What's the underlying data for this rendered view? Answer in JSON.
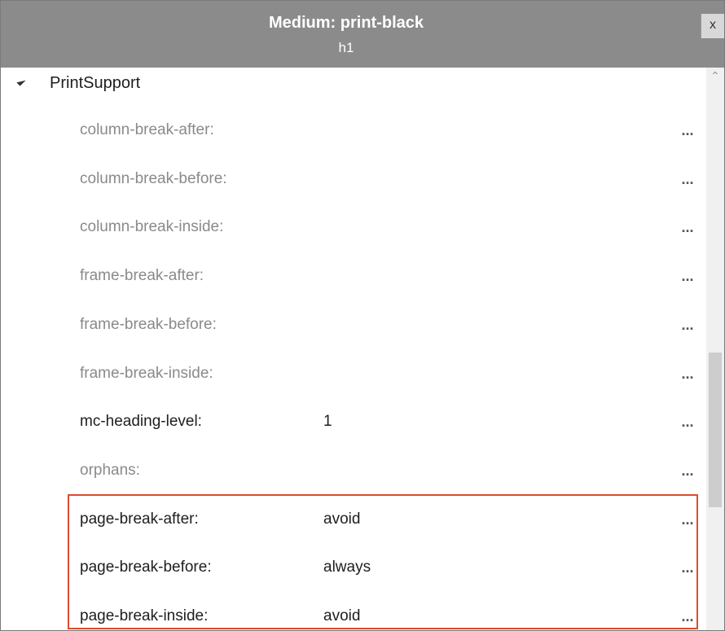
{
  "window": {
    "title": "Medium: print-black",
    "subtitle": "h1",
    "close_label": "x"
  },
  "group": {
    "label": "PrintSupport",
    "expanded": true
  },
  "ellipsis_label": "...",
  "properties": [
    {
      "name": "column-break-after:",
      "value": ""
    },
    {
      "name": "column-break-before:",
      "value": ""
    },
    {
      "name": "column-break-inside:",
      "value": ""
    },
    {
      "name": "frame-break-after:",
      "value": ""
    },
    {
      "name": "frame-break-before:",
      "value": ""
    },
    {
      "name": "frame-break-inside:",
      "value": ""
    },
    {
      "name": "mc-heading-level:",
      "value": "1"
    },
    {
      "name": "orphans:",
      "value": ""
    },
    {
      "name": "page-break-after:",
      "value": "avoid"
    },
    {
      "name": "page-break-before:",
      "value": "always"
    },
    {
      "name": "page-break-inside:",
      "value": "avoid"
    }
  ],
  "colors": {
    "titlebar": "#8b8b8b",
    "highlight": "#e04b2f",
    "unset_text": "#8a8a8a",
    "set_text": "#1e1e1e"
  }
}
